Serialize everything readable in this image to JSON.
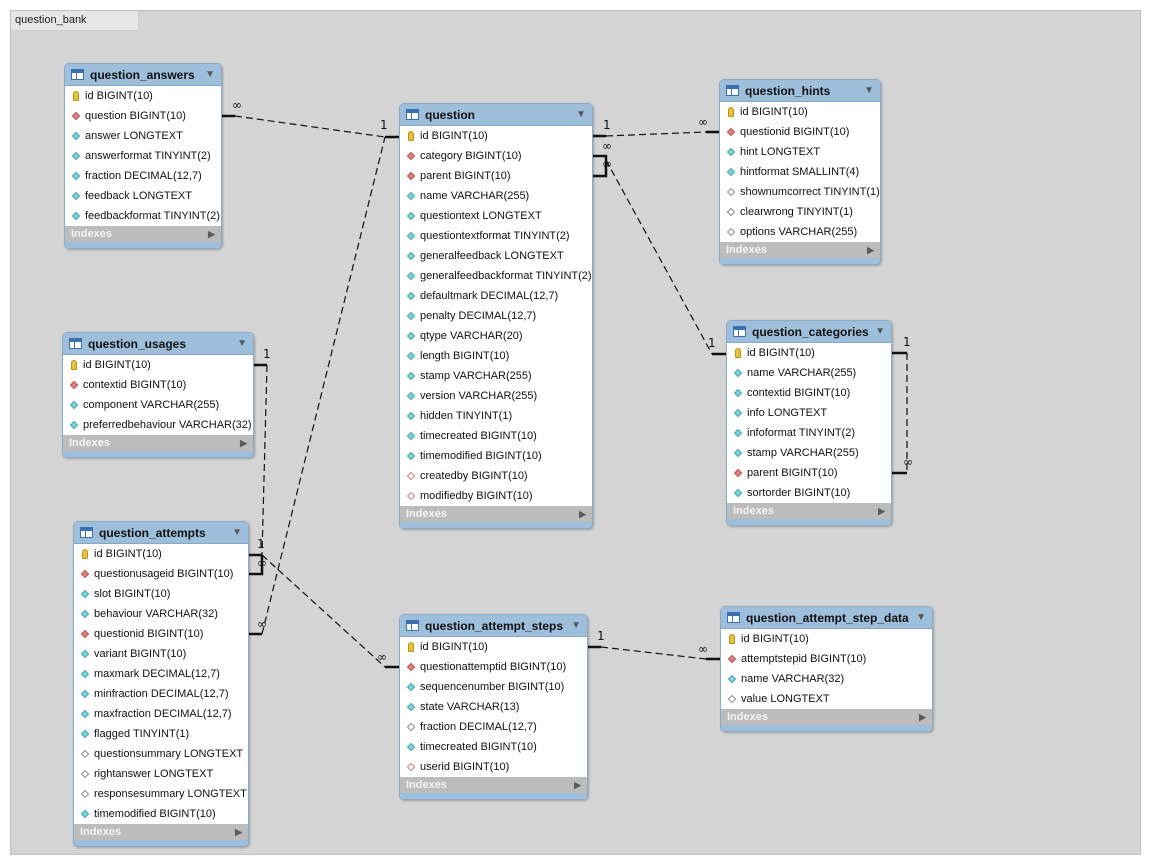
{
  "diagram": {
    "title": "question_bank",
    "indexes_label": "Indexes",
    "one_label": "1",
    "many_label": "∞"
  },
  "tables": {
    "question_answers": {
      "name": "question_answers",
      "columns": [
        {
          "text": "id BIGINT(10)",
          "kind": "pk"
        },
        {
          "text": "question BIGINT(10)",
          "kind": "fk"
        },
        {
          "text": "answer LONGTEXT",
          "kind": "nn"
        },
        {
          "text": "answerformat TINYINT(2)",
          "kind": "nn"
        },
        {
          "text": "fraction DECIMAL(12,7)",
          "kind": "nn"
        },
        {
          "text": "feedback LONGTEXT",
          "kind": "nn"
        },
        {
          "text": "feedbackformat TINYINT(2)",
          "kind": "nn"
        }
      ]
    },
    "question": {
      "name": "question",
      "columns": [
        {
          "text": "id BIGINT(10)",
          "kind": "pk"
        },
        {
          "text": "category BIGINT(10)",
          "kind": "fk"
        },
        {
          "text": "parent BIGINT(10)",
          "kind": "fk"
        },
        {
          "text": "name VARCHAR(255)",
          "kind": "nn"
        },
        {
          "text": "questiontext LONGTEXT",
          "kind": "nn"
        },
        {
          "text": "questiontextformat TINYINT(2)",
          "kind": "nn"
        },
        {
          "text": "generalfeedback LONGTEXT",
          "kind": "nn"
        },
        {
          "text": "generalfeedbackformat TINYINT(2)",
          "kind": "nn"
        },
        {
          "text": "defaultmark DECIMAL(12,7)",
          "kind": "nn"
        },
        {
          "text": "penalty DECIMAL(12,7)",
          "kind": "nn"
        },
        {
          "text": "qtype VARCHAR(20)",
          "kind": "nn"
        },
        {
          "text": "length BIGINT(10)",
          "kind": "nn"
        },
        {
          "text": "stamp VARCHAR(255)",
          "kind": "nn"
        },
        {
          "text": "version VARCHAR(255)",
          "kind": "nn"
        },
        {
          "text": "hidden TINYINT(1)",
          "kind": "nn"
        },
        {
          "text": "timecreated BIGINT(10)",
          "kind": "nn"
        },
        {
          "text": "timemodified BIGINT(10)",
          "kind": "nn"
        },
        {
          "text": "createdby BIGINT(10)",
          "kind": "fkn"
        },
        {
          "text": "modifiedby BIGINT(10)",
          "kind": "fkn"
        }
      ]
    },
    "question_hints": {
      "name": "question_hints",
      "columns": [
        {
          "text": "id BIGINT(10)",
          "kind": "pk"
        },
        {
          "text": "questionid BIGINT(10)",
          "kind": "fk"
        },
        {
          "text": "hint LONGTEXT",
          "kind": "nn"
        },
        {
          "text": "hintformat SMALLINT(4)",
          "kind": "nn"
        },
        {
          "text": "shownumcorrect TINYINT(1)",
          "kind": "nl"
        },
        {
          "text": "clearwrong TINYINT(1)",
          "kind": "nl"
        },
        {
          "text": "options VARCHAR(255)",
          "kind": "nl"
        }
      ]
    },
    "question_usages": {
      "name": "question_usages",
      "columns": [
        {
          "text": "id BIGINT(10)",
          "kind": "pk"
        },
        {
          "text": "contextid BIGINT(10)",
          "kind": "fk"
        },
        {
          "text": "component VARCHAR(255)",
          "kind": "nn"
        },
        {
          "text": "preferredbehaviour VARCHAR(32)",
          "kind": "nn"
        }
      ]
    },
    "question_categories": {
      "name": "question_categories",
      "columns": [
        {
          "text": "id BIGINT(10)",
          "kind": "pk"
        },
        {
          "text": "name VARCHAR(255)",
          "kind": "nn"
        },
        {
          "text": "contextid BIGINT(10)",
          "kind": "nn"
        },
        {
          "text": "info LONGTEXT",
          "kind": "nn"
        },
        {
          "text": "infoformat TINYINT(2)",
          "kind": "nn"
        },
        {
          "text": "stamp VARCHAR(255)",
          "kind": "nn"
        },
        {
          "text": "parent BIGINT(10)",
          "kind": "fk"
        },
        {
          "text": "sortorder BIGINT(10)",
          "kind": "nn"
        }
      ]
    },
    "question_attempts": {
      "name": "question_attempts",
      "columns": [
        {
          "text": "id BIGINT(10)",
          "kind": "pk"
        },
        {
          "text": "questionusageid BIGINT(10)",
          "kind": "fk"
        },
        {
          "text": "slot BIGINT(10)",
          "kind": "nn"
        },
        {
          "text": "behaviour VARCHAR(32)",
          "kind": "nn"
        },
        {
          "text": "questionid BIGINT(10)",
          "kind": "fk"
        },
        {
          "text": "variant BIGINT(10)",
          "kind": "nn"
        },
        {
          "text": "maxmark DECIMAL(12,7)",
          "kind": "nn"
        },
        {
          "text": "minfraction DECIMAL(12,7)",
          "kind": "nn"
        },
        {
          "text": "maxfraction DECIMAL(12,7)",
          "kind": "nn"
        },
        {
          "text": "flagged TINYINT(1)",
          "kind": "nn"
        },
        {
          "text": "questionsummary LONGTEXT",
          "kind": "nl"
        },
        {
          "text": "rightanswer LONGTEXT",
          "kind": "nl"
        },
        {
          "text": "responsesummary LONGTEXT",
          "kind": "nl"
        },
        {
          "text": "timemodified BIGINT(10)",
          "kind": "nn"
        }
      ]
    },
    "question_attempt_steps": {
      "name": "question_attempt_steps",
      "columns": [
        {
          "text": "id BIGINT(10)",
          "kind": "pk"
        },
        {
          "text": "questionattemptid BIGINT(10)",
          "kind": "fk"
        },
        {
          "text": "sequencenumber BIGINT(10)",
          "kind": "nn"
        },
        {
          "text": "state VARCHAR(13)",
          "kind": "nn"
        },
        {
          "text": "fraction DECIMAL(12,7)",
          "kind": "nl"
        },
        {
          "text": "timecreated BIGINT(10)",
          "kind": "nn"
        },
        {
          "text": "userid BIGINT(10)",
          "kind": "fkn"
        }
      ]
    },
    "question_attempt_step_data": {
      "name": "question_attempt_step_data",
      "columns": [
        {
          "text": "id BIGINT(10)",
          "kind": "pk"
        },
        {
          "text": "attemptstepid BIGINT(10)",
          "kind": "fk"
        },
        {
          "text": "name VARCHAR(32)",
          "kind": "nn"
        },
        {
          "text": "value LONGTEXT",
          "kind": "nl"
        }
      ]
    }
  },
  "colors": {
    "header": "#9ebfdc",
    "canvas": "#d4d4d4",
    "fk_marker": "#e07e7e",
    "not_null_marker": "#7fd3d9",
    "pk_marker": "#e8c23a"
  }
}
